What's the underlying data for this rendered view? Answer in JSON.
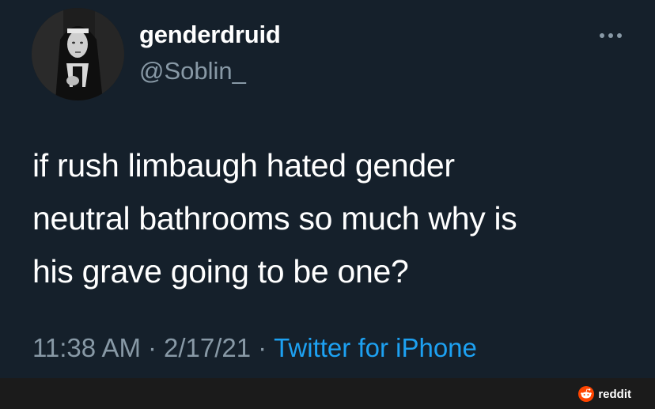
{
  "tweet": {
    "display_name": "genderdruid",
    "handle": "@Soblin_",
    "text_lines": [
      "if rush limbaugh hated gender",
      "neutral bathrooms so much why is",
      "his grave going to be one?"
    ],
    "time": "11:38 AM",
    "separator": "·",
    "date": "2/17/21",
    "source": "Twitter for iPhone",
    "more_icon": "more-horizontal-icon"
  },
  "footer": {
    "watermark_label": "reddit",
    "watermark_icon": "reddit-icon"
  },
  "colors": {
    "background": "#15202b",
    "primary_text": "#ffffff",
    "secondary_text": "#8899a6",
    "link": "#1da1f2",
    "footer_bg": "#1b1b1b",
    "reddit_orange": "#ff4500"
  }
}
